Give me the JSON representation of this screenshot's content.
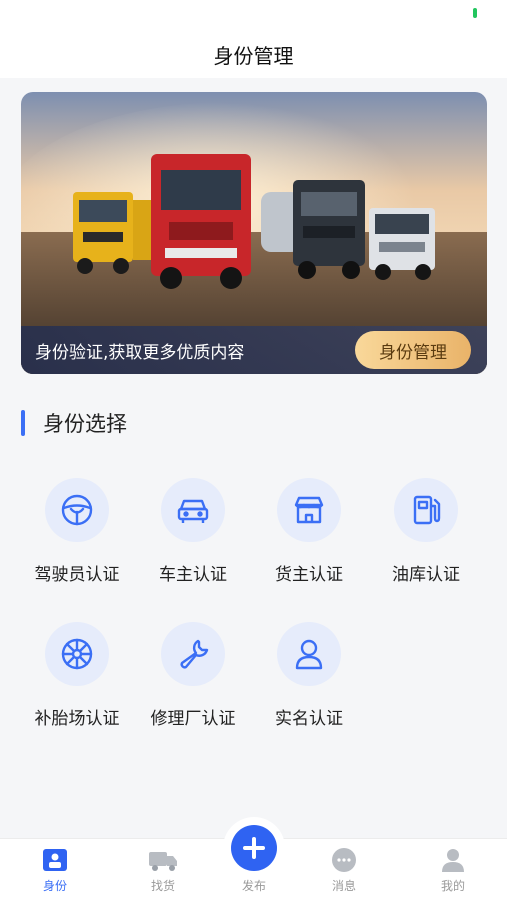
{
  "header": {
    "title": "身份管理"
  },
  "banner": {
    "text": "身份验证,获取更多优质内容",
    "button_label": "身份管理"
  },
  "section": {
    "title": "身份选择"
  },
  "identities": [
    {
      "label": "驾驶员认证",
      "icon": "steering-wheel-icon"
    },
    {
      "label": "车主认证",
      "icon": "car-icon"
    },
    {
      "label": "货主认证",
      "icon": "shop-icon"
    },
    {
      "label": "油库认证",
      "icon": "fuel-pump-icon"
    },
    {
      "label": "补胎场认证",
      "icon": "tire-icon"
    },
    {
      "label": "修理厂认证",
      "icon": "wrench-icon"
    },
    {
      "label": "实名认证",
      "icon": "user-icon"
    }
  ],
  "tabbar": {
    "items": [
      {
        "label": "身份",
        "icon": "id-badge-icon",
        "active": true
      },
      {
        "label": "找货",
        "icon": "truck-icon",
        "active": false
      },
      {
        "label": "发布",
        "icon": "plus-icon",
        "active": false
      },
      {
        "label": "消息",
        "icon": "message-icon",
        "active": false
      },
      {
        "label": "我的",
        "icon": "person-icon",
        "active": false
      }
    ]
  },
  "colors": {
    "accent": "#3b6ff5",
    "icon_bg": "#e6ecfb",
    "button_gold": "#e9b369"
  }
}
